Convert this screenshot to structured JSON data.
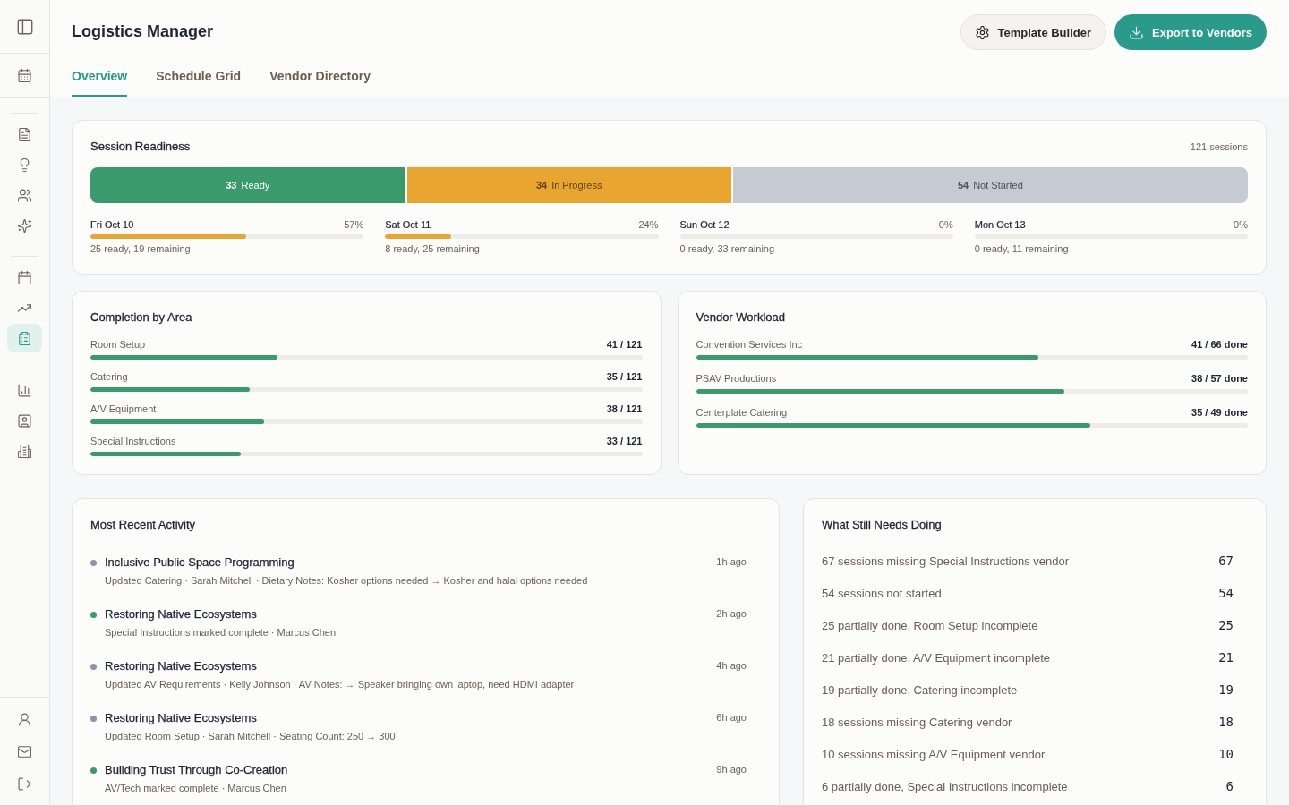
{
  "sidebar": {
    "sections": [
      {
        "items": [
          {
            "selected": false
          }
        ]
      },
      {
        "items": [
          {
            "selected": false
          },
          {
            "selected": false
          },
          {
            "selected": false
          },
          {
            "selected": false
          }
        ]
      },
      {
        "items": [
          {
            "selected": false
          },
          {
            "selected": false
          },
          {
            "selected": true
          }
        ]
      },
      {
        "items": [
          {
            "selected": false
          },
          {
            "selected": false
          },
          {
            "selected": false
          }
        ]
      },
      {
        "items": [
          {
            "selected": false
          },
          {
            "selected": false
          },
          {
            "selected": false
          }
        ]
      }
    ]
  },
  "header": {
    "title": "Logistics Manager",
    "buttons": [
      {
        "label": "Template Builder",
        "kind": "secondary"
      },
      {
        "label": "Export to Vendors",
        "kind": "primary"
      }
    ]
  },
  "tabs": [
    {
      "label": "Overview",
      "selected": true
    },
    {
      "label": "Schedule Grid",
      "selected": false
    },
    {
      "label": "Vendor Directory",
      "selected": false
    }
  ],
  "session_readiness": {
    "title": "Session Readiness",
    "total": "121 sessions",
    "segments": [
      {
        "count": "33",
        "label": "Ready",
        "color": "#3a9a6c"
      },
      {
        "count": "34",
        "label": "In Progress",
        "color": "#e8a530"
      },
      {
        "count": "54",
        "label": "Not Started",
        "color": "#c6cad2"
      }
    ],
    "days": [
      {
        "label": "Fri Oct 10",
        "percent": "57%",
        "level": 0.57,
        "summary": "25 ready, 19 remaining"
      },
      {
        "label": "Sat Oct 11",
        "percent": "24%",
        "level": 0.24,
        "summary": "8 ready, 25 remaining"
      },
      {
        "label": "Sun Oct 12",
        "percent": "0%",
        "summary": "0 ready, 33 remaining"
      },
      {
        "label": "Mon Oct 13",
        "percent": "0%",
        "summary": "0 ready, 11 remaining"
      }
    ]
  },
  "completion_by_area": {
    "title": "Completion by Area",
    "rows": [
      {
        "label": "Room Setup",
        "value": "41 / 121",
        "level": 0.339
      },
      {
        "label": "Catering",
        "value": "35 / 121",
        "level": 0.289
      },
      {
        "label": "A/V Equipment",
        "value": "38 / 121",
        "level": 0.314
      },
      {
        "label": "Special Instructions",
        "value": "33 / 121",
        "level": 0.273
      }
    ]
  },
  "vendor_workload": {
    "title": "Vendor Workload",
    "rows": [
      {
        "label": "Convention Services Inc",
        "value": "41 / 66 done",
        "level": 0.621
      },
      {
        "label": "PSAV Productions",
        "value": "38 / 57 done",
        "level": 0.667
      },
      {
        "label": "Centerplate Catering",
        "value": "35 / 49 done",
        "level": 0.714
      }
    ]
  },
  "recent_activity": {
    "title": "Most Recent Activity",
    "items": [
      {
        "title": "Inclusive Public Space Programming",
        "detail": "Updated Catering · Sarah Mitchell · Dietary Notes: Kosher options needed → Kosher and halal options needed",
        "time": "1h ago",
        "color": "#8b93a6"
      },
      {
        "title": "Restoring Native Ecosystems",
        "detail": "Special Instructions marked complete · Marcus Chen",
        "time": "2h ago",
        "color": "#3a9a6c"
      },
      {
        "title": "Restoring Native Ecosystems",
        "detail": "Updated AV Requirements · Kelly Johnson · AV Notes: → Speaker bringing own laptop, need HDMI adapter",
        "time": "4h ago",
        "color": "#8b93a6"
      },
      {
        "title": "Restoring Native Ecosystems",
        "detail": "Updated Room Setup · Sarah Mitchell · Seating Count: 250 → 300",
        "time": "6h ago",
        "color": "#8b93a6"
      },
      {
        "title": "Building Trust Through Co-Creation",
        "detail": "AV/Tech marked complete · Marcus Chen",
        "time": "9h ago",
        "color": "#3a9a6c"
      }
    ]
  },
  "needs_doing": {
    "title": "What Still Needs Doing",
    "items": [
      {
        "text": "67 sessions missing Special Instructions vendor",
        "count": "67"
      },
      {
        "text": "54 sessions not started",
        "count": "54"
      },
      {
        "text": "25 partially done, Room Setup incomplete",
        "count": "25"
      },
      {
        "text": "21 partially done, A/V Equipment incomplete",
        "count": "21"
      },
      {
        "text": "19 partially done, Catering incomplete",
        "count": "19"
      },
      {
        "text": "18 sessions missing Catering vendor",
        "count": "18"
      },
      {
        "text": "10 sessions missing A/V Equipment vendor",
        "count": "10"
      },
      {
        "text": "6 partially done, Special Instructions incomplete",
        "count": "6"
      }
    ]
  }
}
